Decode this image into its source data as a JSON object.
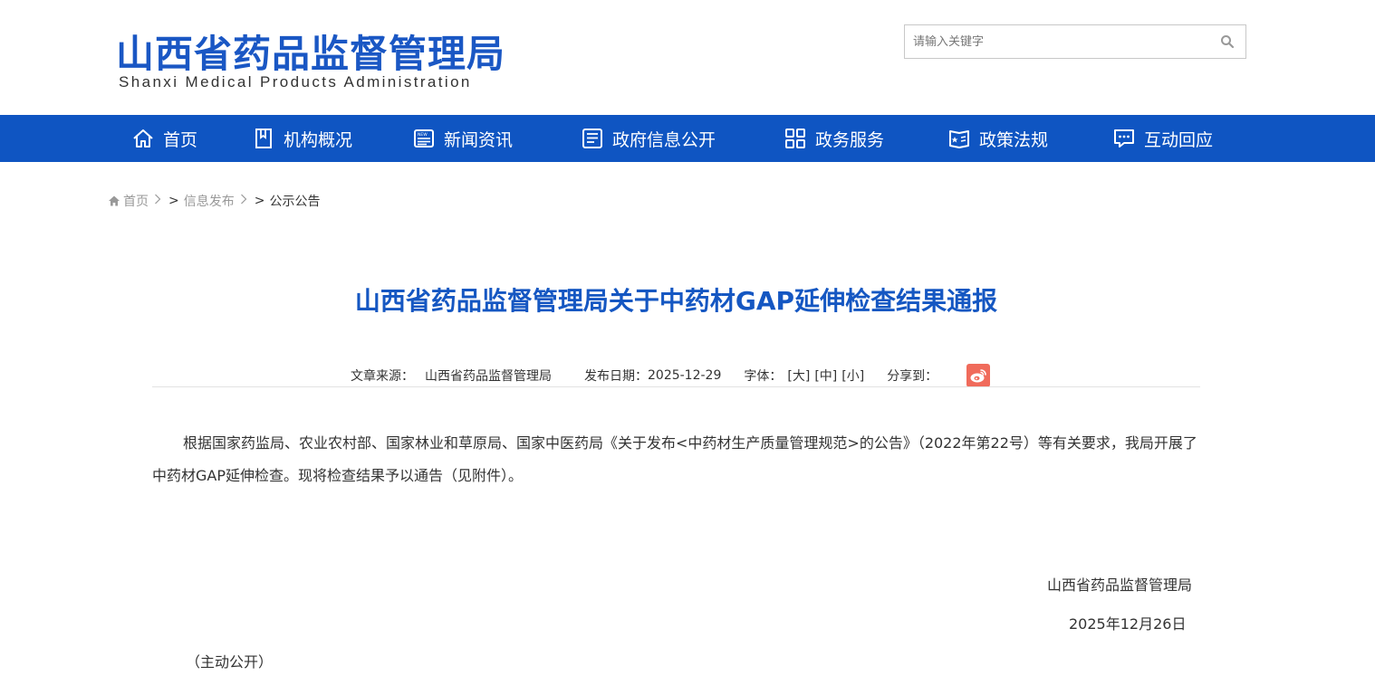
{
  "header": {
    "logo_cn": "山西省药品监督管理局",
    "logo_en": "Shanxi Medical Products Administration",
    "search_placeholder": "请输入关键字",
    "brand_color": "#1a57c4"
  },
  "nav": {
    "background": "#0f55c2",
    "items": [
      {
        "label": "首页",
        "icon": "home-icon"
      },
      {
        "label": "机构概况",
        "icon": "book-icon"
      },
      {
        "label": "新闻资讯",
        "icon": "newspaper-icon"
      },
      {
        "label": "政府信息公开",
        "icon": "document-list-icon"
      },
      {
        "label": "政务服务",
        "icon": "grid-icon"
      },
      {
        "label": "政策法规",
        "icon": "policy-book-icon"
      },
      {
        "label": "互动回应",
        "icon": "chat-icon"
      }
    ]
  },
  "breadcrumb": {
    "home": "首页",
    "level1": "信息发布",
    "level2": "公示公告",
    "separator": ">",
    "gt": ">"
  },
  "article": {
    "title": "山西省药品监督管理局关于中药材GAP延伸检查结果通报",
    "meta": {
      "source_label": "文章来源：",
      "source": "山西省药品监督管理局",
      "date_label": "发布日期：",
      "date": "2025-12-29",
      "font_label": "字体：",
      "font_large": "[大]",
      "font_medium": "[中]",
      "font_small": "[小]",
      "share_label": "分享到：",
      "share_icon": "weibo-icon"
    },
    "body": "根据国家药监局、农业农村部、国家林业和草原局、国家中医药局《关于发布<中药材生产质量管理规范>的公告》（2022年第22号）等有关要求，我局开展了中药材GAP延伸检查。现将检查结果予以通告（见附件）。",
    "signature_org": "山西省药品监督管理局",
    "signature_date": "2025年12月26日",
    "public_note": "（主动公开）"
  }
}
